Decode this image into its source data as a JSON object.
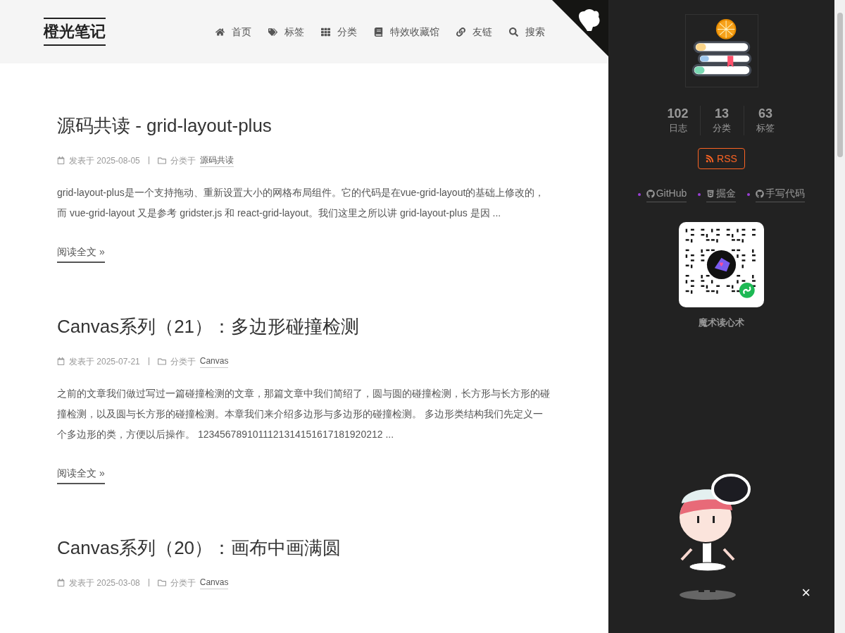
{
  "site": {
    "title": "橙光笔记"
  },
  "nav": [
    {
      "label": "首页",
      "kind": "home"
    },
    {
      "label": "标签",
      "kind": "tags"
    },
    {
      "label": "分类",
      "kind": "categories"
    },
    {
      "label": "特效收藏馆",
      "kind": "effects"
    },
    {
      "label": "友链",
      "kind": "friends"
    },
    {
      "label": "搜索",
      "kind": "search"
    }
  ],
  "posts": [
    {
      "title": "源码共读 - grid-layout-plus",
      "date_label": "发表于",
      "date": "2025-08-05",
      "category_label": "分类于",
      "category": "源码共读",
      "excerpt": "grid-layout-plus是一个支持拖动、重新设置大小的网格布局组件。它的代码是在vue-grid-layout的基础上修改的，而 vue-grid-layout 又是参考 gridster.js 和 react-grid-layout。我们这里之所以讲 grid-layout-plus 是因 ...",
      "read_more": "阅读全文 »"
    },
    {
      "title": "Canvas系列（21）：多边形碰撞检测",
      "date_label": "发表于",
      "date": "2025-07-21",
      "category_label": "分类于",
      "category": "Canvas",
      "excerpt": "之前的文章我们做过写过一篇碰撞检测的文章，那篇文章中我们简绍了，圆与圆的碰撞检测，长方形与长方形的碰撞检测，以及圆与长方形的碰撞检测。本章我们来介绍多边形与多边形的碰撞检测。 多边形类结构我们先定义一个多边形的类，方便以后操作。 1234567891011121314151617181920212 ...",
      "read_more": "阅读全文 »"
    },
    {
      "title": "Canvas系列（20）：画布中画满圆",
      "date_label": "发表于",
      "date": "2025-03-08",
      "category_label": "分类于",
      "category": "Canvas"
    }
  ],
  "sidebar": {
    "stats": [
      {
        "count": "102",
        "label": "日志"
      },
      {
        "count": "13",
        "label": "分类"
      },
      {
        "count": "63",
        "label": "标签"
      }
    ],
    "rss": "RSS",
    "links": [
      {
        "label": "GitHub",
        "kind": "repo"
      },
      {
        "label": "掘金",
        "kind": "blog"
      },
      {
        "label": "手写代码",
        "kind": "repo"
      }
    ],
    "qr_caption": "魔术读心术"
  },
  "close": "×"
}
